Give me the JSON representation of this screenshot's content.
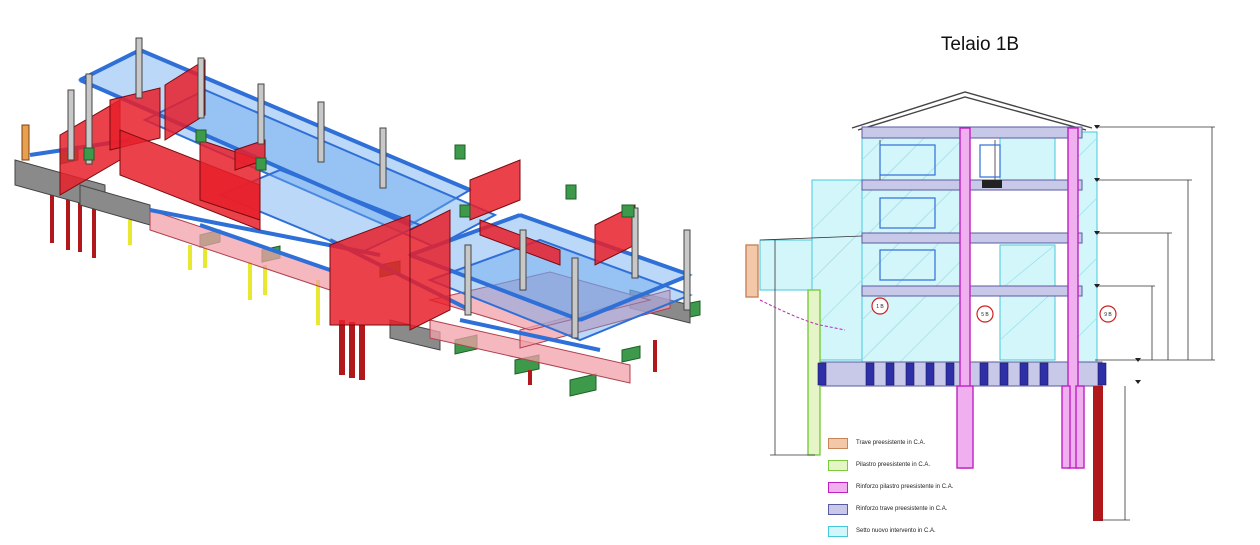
{
  "drawing": {
    "title": "Telaio 1B",
    "frame_tags": [
      "1 B",
      "5 B",
      "9 B"
    ]
  },
  "legend": [
    {
      "label": "Trave preesistente in C.A.",
      "fill": "#f2c8a8",
      "stroke": "#c8845a"
    },
    {
      "label": "Pilastro preesistente in C.A.",
      "fill": "#e6f5c8",
      "stroke": "#7acc3c"
    },
    {
      "label": "Rinforzo pilastro preesistente in C.A.",
      "fill": "#f0b0f0",
      "stroke": "#c020c0"
    },
    {
      "label": "Rinforzo trave preesistente in C.A.",
      "fill": "#c8c8e8",
      "stroke": "#5a5aa0"
    },
    {
      "label": "Setto nuovo intervento in C.A.",
      "fill": "#d2f6fa",
      "stroke": "#46c8dc"
    }
  ],
  "colors": {
    "wall_red": "#e8202a",
    "glass_blue": "#6aa8f0",
    "beam_blue": "#2f6fd8",
    "footing_green": "#3c9a4a",
    "pile_yellow": "#e8e830",
    "pile_red": "#b0181c",
    "concrete_grey": "#8a8a8a",
    "pink_slab": "#f0a0a8"
  }
}
